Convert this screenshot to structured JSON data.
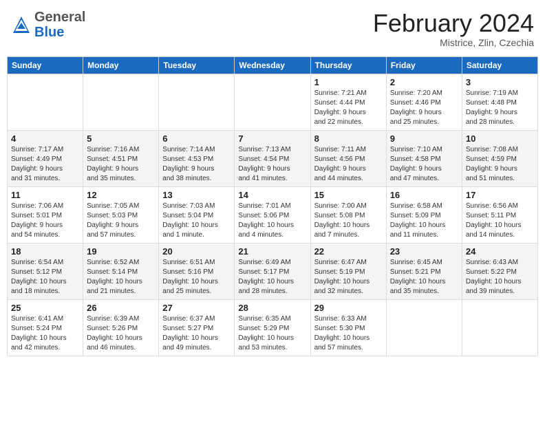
{
  "header": {
    "logo_general": "General",
    "logo_blue": "Blue",
    "month_title": "February 2024",
    "location": "Mistrice, Zlin, Czechia"
  },
  "days_of_week": [
    "Sunday",
    "Monday",
    "Tuesday",
    "Wednesday",
    "Thursday",
    "Friday",
    "Saturday"
  ],
  "weeks": [
    [
      {
        "day": "",
        "info": ""
      },
      {
        "day": "",
        "info": ""
      },
      {
        "day": "",
        "info": ""
      },
      {
        "day": "",
        "info": ""
      },
      {
        "day": "1",
        "info": "Sunrise: 7:21 AM\nSunset: 4:44 PM\nDaylight: 9 hours\nand 22 minutes."
      },
      {
        "day": "2",
        "info": "Sunrise: 7:20 AM\nSunset: 4:46 PM\nDaylight: 9 hours\nand 25 minutes."
      },
      {
        "day": "3",
        "info": "Sunrise: 7:19 AM\nSunset: 4:48 PM\nDaylight: 9 hours\nand 28 minutes."
      }
    ],
    [
      {
        "day": "4",
        "info": "Sunrise: 7:17 AM\nSunset: 4:49 PM\nDaylight: 9 hours\nand 31 minutes."
      },
      {
        "day": "5",
        "info": "Sunrise: 7:16 AM\nSunset: 4:51 PM\nDaylight: 9 hours\nand 35 minutes."
      },
      {
        "day": "6",
        "info": "Sunrise: 7:14 AM\nSunset: 4:53 PM\nDaylight: 9 hours\nand 38 minutes."
      },
      {
        "day": "7",
        "info": "Sunrise: 7:13 AM\nSunset: 4:54 PM\nDaylight: 9 hours\nand 41 minutes."
      },
      {
        "day": "8",
        "info": "Sunrise: 7:11 AM\nSunset: 4:56 PM\nDaylight: 9 hours\nand 44 minutes."
      },
      {
        "day": "9",
        "info": "Sunrise: 7:10 AM\nSunset: 4:58 PM\nDaylight: 9 hours\nand 47 minutes."
      },
      {
        "day": "10",
        "info": "Sunrise: 7:08 AM\nSunset: 4:59 PM\nDaylight: 9 hours\nand 51 minutes."
      }
    ],
    [
      {
        "day": "11",
        "info": "Sunrise: 7:06 AM\nSunset: 5:01 PM\nDaylight: 9 hours\nand 54 minutes."
      },
      {
        "day": "12",
        "info": "Sunrise: 7:05 AM\nSunset: 5:03 PM\nDaylight: 9 hours\nand 57 minutes."
      },
      {
        "day": "13",
        "info": "Sunrise: 7:03 AM\nSunset: 5:04 PM\nDaylight: 10 hours\nand 1 minute."
      },
      {
        "day": "14",
        "info": "Sunrise: 7:01 AM\nSunset: 5:06 PM\nDaylight: 10 hours\nand 4 minutes."
      },
      {
        "day": "15",
        "info": "Sunrise: 7:00 AM\nSunset: 5:08 PM\nDaylight: 10 hours\nand 7 minutes."
      },
      {
        "day": "16",
        "info": "Sunrise: 6:58 AM\nSunset: 5:09 PM\nDaylight: 10 hours\nand 11 minutes."
      },
      {
        "day": "17",
        "info": "Sunrise: 6:56 AM\nSunset: 5:11 PM\nDaylight: 10 hours\nand 14 minutes."
      }
    ],
    [
      {
        "day": "18",
        "info": "Sunrise: 6:54 AM\nSunset: 5:12 PM\nDaylight: 10 hours\nand 18 minutes."
      },
      {
        "day": "19",
        "info": "Sunrise: 6:52 AM\nSunset: 5:14 PM\nDaylight: 10 hours\nand 21 minutes."
      },
      {
        "day": "20",
        "info": "Sunrise: 6:51 AM\nSunset: 5:16 PM\nDaylight: 10 hours\nand 25 minutes."
      },
      {
        "day": "21",
        "info": "Sunrise: 6:49 AM\nSunset: 5:17 PM\nDaylight: 10 hours\nand 28 minutes."
      },
      {
        "day": "22",
        "info": "Sunrise: 6:47 AM\nSunset: 5:19 PM\nDaylight: 10 hours\nand 32 minutes."
      },
      {
        "day": "23",
        "info": "Sunrise: 6:45 AM\nSunset: 5:21 PM\nDaylight: 10 hours\nand 35 minutes."
      },
      {
        "day": "24",
        "info": "Sunrise: 6:43 AM\nSunset: 5:22 PM\nDaylight: 10 hours\nand 39 minutes."
      }
    ],
    [
      {
        "day": "25",
        "info": "Sunrise: 6:41 AM\nSunset: 5:24 PM\nDaylight: 10 hours\nand 42 minutes."
      },
      {
        "day": "26",
        "info": "Sunrise: 6:39 AM\nSunset: 5:26 PM\nDaylight: 10 hours\nand 46 minutes."
      },
      {
        "day": "27",
        "info": "Sunrise: 6:37 AM\nSunset: 5:27 PM\nDaylight: 10 hours\nand 49 minutes."
      },
      {
        "day": "28",
        "info": "Sunrise: 6:35 AM\nSunset: 5:29 PM\nDaylight: 10 hours\nand 53 minutes."
      },
      {
        "day": "29",
        "info": "Sunrise: 6:33 AM\nSunset: 5:30 PM\nDaylight: 10 hours\nand 57 minutes."
      },
      {
        "day": "",
        "info": ""
      },
      {
        "day": "",
        "info": ""
      }
    ]
  ]
}
